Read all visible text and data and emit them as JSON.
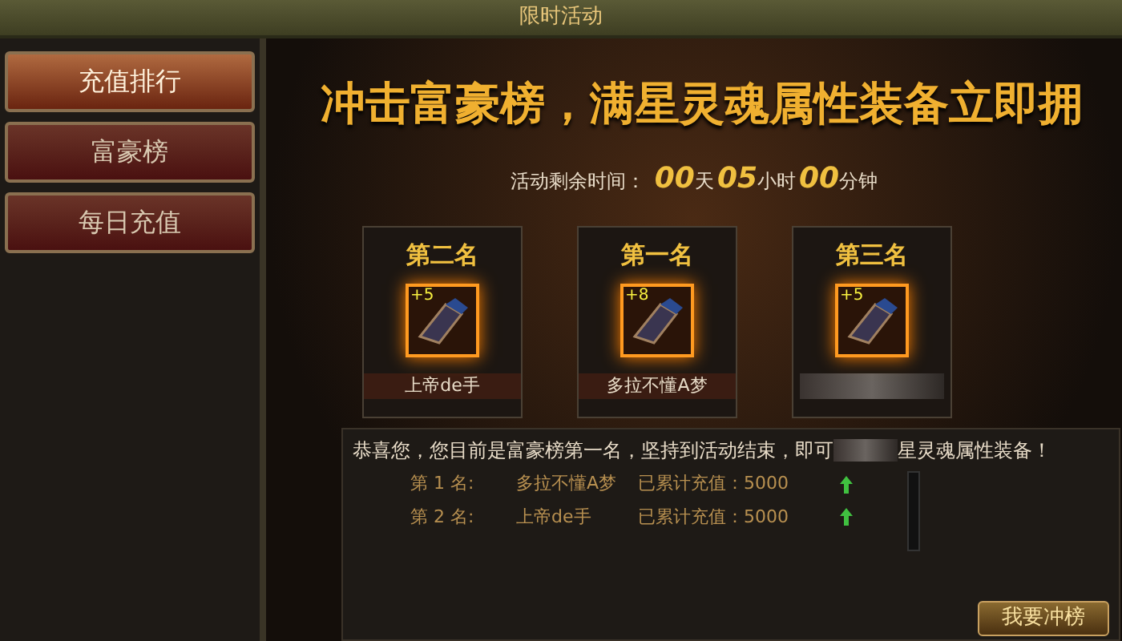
{
  "title": "限时活动",
  "sidebar": {
    "items": [
      {
        "label": "充值排行",
        "selected": true
      },
      {
        "label": "富豪榜",
        "selected": false
      },
      {
        "label": "每日充值",
        "selected": false
      }
    ]
  },
  "banner": {
    "headline": "冲击富豪榜，满星灵魂属性装备立即拥"
  },
  "countdown": {
    "label": "活动剩余时间：",
    "parts": [
      {
        "value": "00",
        "unit": "天"
      },
      {
        "value": "05",
        "unit": "小时"
      },
      {
        "value": "00",
        "unit": "分钟"
      }
    ]
  },
  "prizes": [
    {
      "rank": "第二名",
      "plus": "+5",
      "name": "上帝de手"
    },
    {
      "rank": "第一名",
      "plus": "+8",
      "name": "多拉不懂A梦"
    },
    {
      "rank": "第三名",
      "plus": "+5"
    }
  ],
  "message": {
    "before": "恭喜您，您目前是富豪榜第一名，坚持到活动结束，即可",
    "after": "星灵魂属性装备！"
  },
  "ranking": [
    {
      "rank": "第 1 名:",
      "name": "多拉不懂A梦",
      "total": "已累计充值：5000"
    },
    {
      "rank": "第 2 名:",
      "name": "上帝de手",
      "total": "已累计充值：5000"
    }
  ],
  "button": {
    "label": "我要冲榜"
  }
}
